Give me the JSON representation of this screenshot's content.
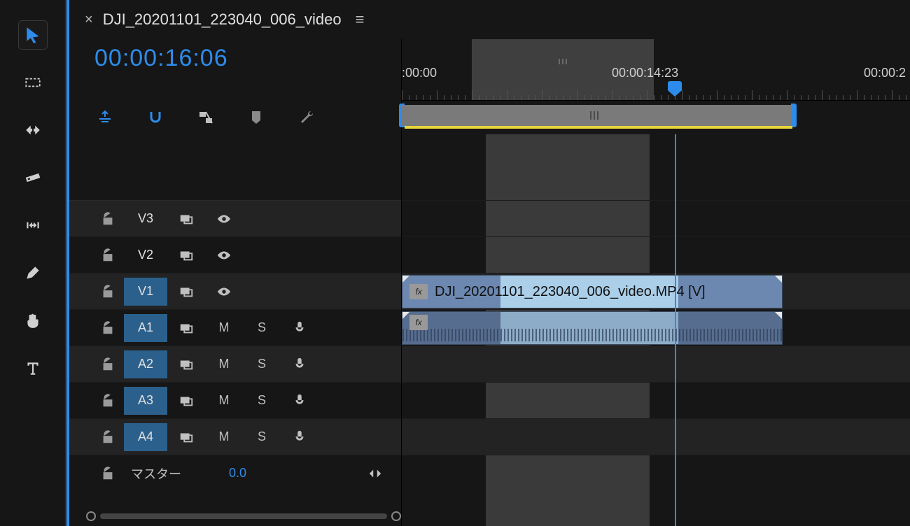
{
  "sequence": {
    "tab_name": "DJI_20201101_223040_006_video",
    "timecode": "00:00:16:06"
  },
  "ruler": {
    "start_label": ":00:00",
    "mid_label": "00:00:14:23",
    "end_label": "00:00:2"
  },
  "tracks": {
    "video": [
      {
        "id": "V3",
        "selected": false
      },
      {
        "id": "V2",
        "selected": false
      },
      {
        "id": "V1",
        "selected": true
      }
    ],
    "audio": [
      {
        "id": "A1",
        "selected": true
      },
      {
        "id": "A2",
        "selected": true
      },
      {
        "id": "A3",
        "selected": true
      },
      {
        "id": "A4",
        "selected": true
      }
    ],
    "ctrl": {
      "mute": "M",
      "solo": "S"
    },
    "master": {
      "label": "マスター",
      "value": "0.0"
    }
  },
  "clips": {
    "v1": {
      "name": "DJI_20201101_223040_006_video.MP4 [V]",
      "fx": "fx"
    },
    "a1": {
      "fx": "fx"
    }
  },
  "colors": {
    "accent": "#2d8ceb"
  }
}
